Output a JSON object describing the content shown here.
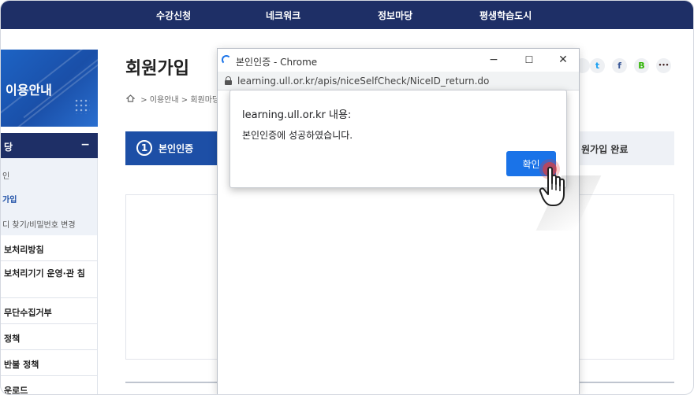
{
  "topnav": {
    "items": [
      "수강신청",
      "네크워크",
      "정보마당",
      "평생학습도시"
    ]
  },
  "sidebar": {
    "banner_title": "이용안내",
    "section_title": "당",
    "section_toggle": "−",
    "sub_items": [
      {
        "label": "인",
        "active": false
      },
      {
        "label": "가입",
        "active": true
      },
      {
        "label": "디 찾기/비밀번호 변경",
        "active": false
      }
    ],
    "items": [
      "보처리방침",
      "보처리기기 운영·관 침",
      "무단수집거부",
      "정책",
      "반불 정책",
      "운로드"
    ]
  },
  "main": {
    "page_title": "회원가입",
    "breadcrumb": [
      "이용안내",
      "회원마당"
    ],
    "breadcrumb_sep": ">",
    "steps": {
      "active_number": "1",
      "active_label": "본인인증",
      "last_label": "원가입 완료"
    }
  },
  "share_icons": [
    {
      "name": "print-icon",
      "glyph": "",
      "color": "#777777"
    },
    {
      "name": "twitter-icon",
      "glyph": "t",
      "color": "#1da1f2"
    },
    {
      "name": "facebook-icon",
      "glyph": "f",
      "color": "#3b5998"
    },
    {
      "name": "blog-icon",
      "glyph": "B",
      "color": "#2db400"
    },
    {
      "name": "talk-icon",
      "glyph": "•••",
      "color": "#3c1e1e"
    }
  ],
  "popup": {
    "window_title": "본인인증 - Chrome",
    "url": "learning.ull.or.kr/apis/niceSelfCheck/NiceID_return.do",
    "minimize": "−",
    "maximize": "☐",
    "close": "✕"
  },
  "alert": {
    "origin": "learning.ull.or.kr 내용:",
    "message": "본인인증에 성공하였습니다.",
    "ok_label": "확인"
  },
  "colors": {
    "nav_bg": "#1e2f66",
    "accent_blue": "#1d4fa6",
    "chrome_button": "#1a73e8",
    "click_indicator": "#e53935"
  }
}
